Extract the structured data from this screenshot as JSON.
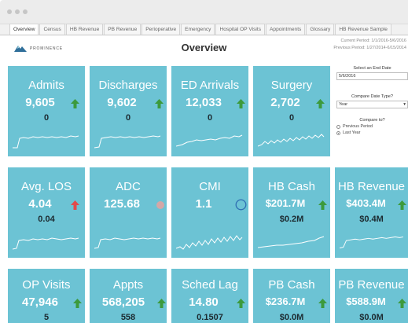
{
  "window": {
    "title": ""
  },
  "tabs": [
    {
      "label": "Overview"
    },
    {
      "label": "Census"
    },
    {
      "label": "HB Revenue"
    },
    {
      "label": "PB Revenue"
    },
    {
      "label": "Perioperative"
    },
    {
      "label": "Emergency"
    },
    {
      "label": "Hospital OP Visits"
    },
    {
      "label": "Appointments"
    },
    {
      "label": "Glossary"
    },
    {
      "label": "HB Revenue Sample"
    }
  ],
  "header": {
    "brand": "PROMINENCE",
    "title": "Overview",
    "current_period": "Current Period: 1/1/2016-5/6/2016",
    "previous_period": "Previous Period: 1/27/2014-6/15/2014"
  },
  "controls": {
    "end_date_label": "Select an End Date",
    "end_date_value": "5/6/2016",
    "date_type_label": "Compare Date Type?",
    "date_type_value": "Year",
    "compare_label": "Compare to?",
    "options": [
      "Previous Period",
      "Last Year"
    ],
    "selected_option": "Last Year"
  },
  "colors": {
    "card": "#6cc3d4",
    "up": "#3c9a3c",
    "down": "#e24a4a",
    "neutral": "#d4a7a7",
    "circle": "#2f6fb3"
  },
  "cards": [
    {
      "title": "Admits",
      "value": "9,605",
      "delta": "0",
      "indicator": "up-arrow-icon"
    },
    {
      "title": "Discharges",
      "value": "9,602",
      "delta": "0",
      "indicator": "up-arrow-icon"
    },
    {
      "title": "ED Arrivals",
      "value": "12,033",
      "delta": "0",
      "indicator": "up-arrow-icon"
    },
    {
      "title": "Surgery",
      "value": "2,702",
      "delta": "0",
      "indicator": "up-arrow-icon"
    },
    {
      "title": "Avg. LOS",
      "value": "4.04",
      "delta": "0.04",
      "indicator": "down-arrow-icon"
    },
    {
      "title": "ADC",
      "value": "125.68",
      "delta": "",
      "indicator": "neutral-dot-icon"
    },
    {
      "title": "CMI",
      "value": "1.1",
      "delta": "",
      "indicator": "circle-icon"
    },
    {
      "title": "HB Cash",
      "value": "$201.7M",
      "delta": "$0.2M",
      "indicator": "up-arrow-icon"
    },
    {
      "title": "HB Revenue",
      "value": "$403.4M",
      "delta": "$0.4M",
      "indicator": "up-arrow-icon"
    },
    {
      "title": "OP Visits",
      "value": "47,946",
      "delta": "5",
      "indicator": "up-arrow-icon"
    },
    {
      "title": "Appts",
      "value": "568,205",
      "delta": "558",
      "indicator": "up-arrow-icon"
    },
    {
      "title": "Sched Lag",
      "value": "14.80",
      "delta": "0.1507",
      "indicator": "up-arrow-icon"
    },
    {
      "title": "PB Cash",
      "value": "$236.7M",
      "delta": "$0.0M",
      "indicator": "up-arrow-icon"
    },
    {
      "title": "PB Revenue",
      "value": "$588.9M",
      "delta": "$0.0M",
      "indicator": "up-arrow-icon"
    }
  ]
}
